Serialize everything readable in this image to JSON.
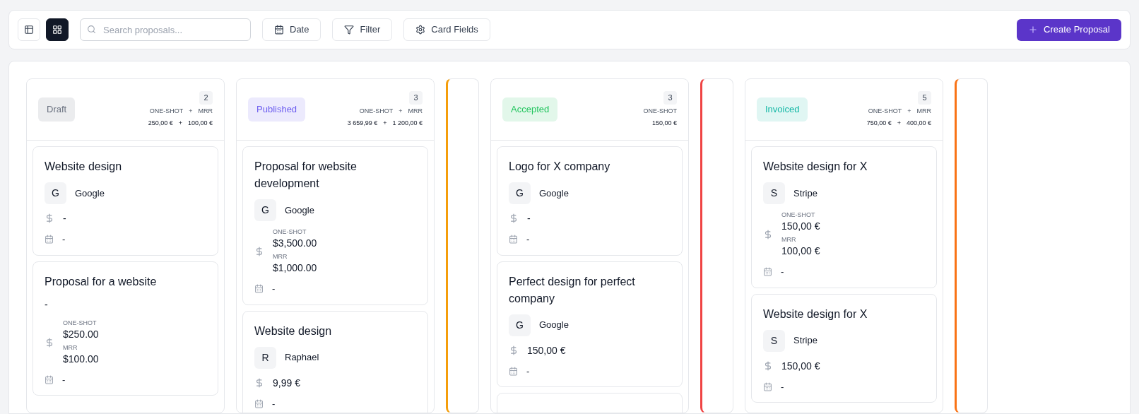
{
  "toolbar": {
    "views": [
      {
        "kind": "list",
        "selected": false
      },
      {
        "kind": "grid",
        "selected": true
      }
    ],
    "search": {
      "placeholder": "Search proposals..."
    },
    "buttons": [
      {
        "kind": "date",
        "label": "Date"
      },
      {
        "kind": "filter",
        "label": "Filter"
      },
      {
        "kind": "fields",
        "label": "Card Fields"
      }
    ],
    "create_button": {
      "label": "Create Proposal"
    }
  },
  "columns": [
    {
      "kind": "expanded",
      "status": "Draft",
      "color": "#6b7280",
      "count": "2",
      "total_labels": [
        "ONE-SHOT",
        "+",
        "MRR"
      ],
      "total_values": [
        "250,00 €",
        "+",
        "100,00 €"
      ],
      "cards": [
        {
          "title": "Website design",
          "client": {
            "initial": "G",
            "name": "Google"
          },
          "amounts": [
            {
              "value": "-"
            }
          ],
          "date": "-"
        },
        {
          "title": "Proposal for a website",
          "client_text": "-",
          "amounts": [
            {
              "label": "ONE-SHOT",
              "value": "$250.00"
            },
            {
              "label": "MRR",
              "value": "$100.00"
            }
          ],
          "date": "-"
        }
      ]
    },
    {
      "kind": "expanded",
      "status": "Published",
      "color": "#6d5ef0",
      "count": "3",
      "total_labels": [
        "ONE-SHOT",
        "+",
        "MRR"
      ],
      "total_values": [
        "3 659,99 €",
        "+",
        "1 200,00 €"
      ],
      "cards": [
        {
          "title": "Proposal for website development",
          "client": {
            "initial": "G",
            "name": "Google"
          },
          "amounts": [
            {
              "label": "ONE-SHOT",
              "value": "$3,500.00"
            },
            {
              "label": "MRR",
              "value": "$1,000.00"
            }
          ],
          "date": "-"
        },
        {
          "title": "Website design",
          "client": {
            "initial": "R",
            "name": "Raphael"
          },
          "amounts": [
            {
              "value": "9,99 €"
            }
          ],
          "date": "-"
        }
      ]
    },
    {
      "kind": "collapsed",
      "color": "#f59e0b"
    },
    {
      "kind": "expanded",
      "status": "Accepted",
      "color": "#22c55e",
      "count": "3",
      "total_labels": [
        "ONE-SHOT"
      ],
      "total_values": [
        "150,00 €"
      ],
      "cards": [
        {
          "title": "Logo for X company",
          "client": {
            "initial": "G",
            "name": "Google"
          },
          "amounts": [
            {
              "value": "-"
            }
          ],
          "date": "-"
        },
        {
          "title": "Perfect design for perfect company",
          "client": {
            "initial": "G",
            "name": "Google"
          },
          "amounts": [
            {
              "value": "150,00 €"
            }
          ],
          "date": "-"
        },
        {
          "kind": "cut_off"
        }
      ]
    },
    {
      "kind": "collapsed",
      "color": "#ef4444"
    },
    {
      "kind": "expanded",
      "status": "Invoiced",
      "color": "#14b8a6",
      "count": "5",
      "total_labels": [
        "ONE-SHOT",
        "+",
        "MRR"
      ],
      "total_values": [
        "750,00 €",
        "+",
        "400,00 €"
      ],
      "cards": [
        {
          "title": "Website design for X",
          "client": {
            "initial": "S",
            "name": "Stripe"
          },
          "amounts": [
            {
              "label": "ONE-SHOT",
              "value": "150,00 €"
            },
            {
              "label": "MRR",
              "value": "100,00 €"
            }
          ],
          "date": "-"
        },
        {
          "title": "Website design for X",
          "client": {
            "initial": "S",
            "name": "Stripe"
          },
          "amounts": [
            {
              "value": "150,00 €"
            }
          ],
          "date": "-"
        }
      ]
    },
    {
      "kind": "collapsed",
      "color": "#f97316"
    }
  ]
}
